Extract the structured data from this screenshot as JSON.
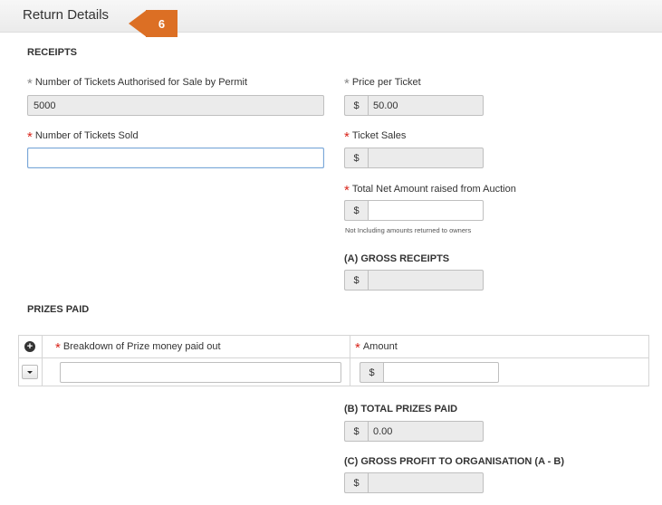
{
  "header": {
    "title": "Return Details",
    "step_badge": "6"
  },
  "receipts": {
    "title": "RECEIPTS",
    "tickets_authorised": {
      "label": "Number of Tickets Authorised for Sale by Permit",
      "value": "5000"
    },
    "price_per_ticket": {
      "label": "Price per Ticket",
      "currency": "$",
      "value": "50.00"
    },
    "tickets_sold": {
      "label": "Number of Tickets Sold",
      "value": ""
    },
    "ticket_sales": {
      "label": "Ticket Sales",
      "currency": "$",
      "value": ""
    },
    "auction": {
      "label": "Total Net Amount raised from Auction",
      "currency": "$",
      "value": "",
      "note": "Not Including amounts returned to owners"
    },
    "gross_receipts": {
      "label": "(A) GROSS RECEIPTS",
      "currency": "$",
      "value": ""
    }
  },
  "prizes": {
    "title": "PRIZES PAID",
    "col_breakdown": "Breakdown of Prize money paid out",
    "col_amount": "Amount",
    "row_currency": "$",
    "row_breakdown_value": "",
    "row_amount_value": ""
  },
  "totals": {
    "total_prizes": {
      "label": "(B) TOTAL PRIZES PAID",
      "currency": "$",
      "value": "0.00"
    },
    "gross_profit": {
      "label": "(C) GROSS PROFIT TO ORGANISATION (A - B)",
      "currency": "$",
      "value": ""
    }
  }
}
